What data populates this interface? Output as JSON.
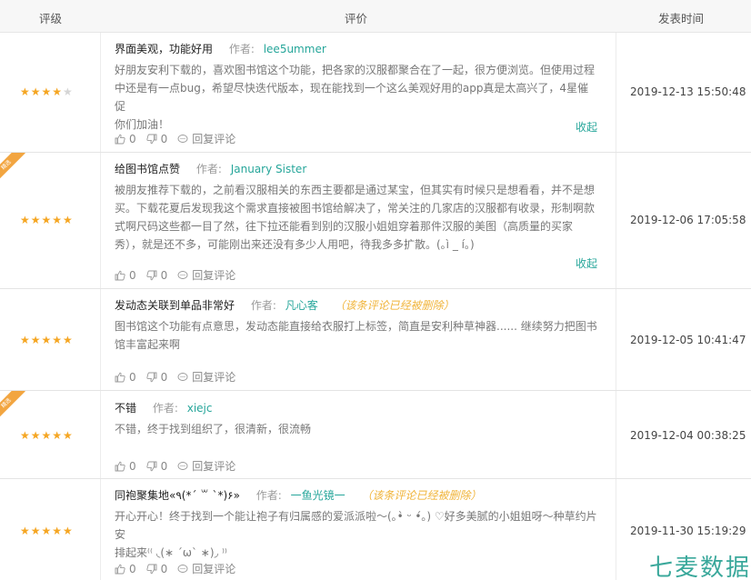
{
  "header": {
    "rating": "评级",
    "review": "评价",
    "time": "发表时间"
  },
  "labels": {
    "author": "作者:",
    "collapse": "收起",
    "reply": "回复评论"
  },
  "reviews": [
    {
      "title": "界面美观，功能好用",
      "author": "lee5ummer",
      "deleted": "",
      "stars": "★★★★",
      "stars_empty": "★",
      "rating": 4,
      "lines": [
        "好朋友安利下载的，喜欢图书馆这个功能，把各家的汉服都聚合在了一起，很方便浏览。但使用过程",
        "中还是有一点bug，希望尽快迭代版本，现在能找到一个这么美观好用的app真是太高兴了，4星催促",
        "你们加油！"
      ],
      "likes": "0",
      "dislikes": "0",
      "time": "2019-12-13 15:50:48",
      "ribbon": ""
    },
    {
      "title": "给图书馆点赞",
      "author": "January Sister",
      "deleted": "",
      "stars": "★★★★★",
      "stars_empty": "",
      "rating": 5,
      "lines": [
        "被朋友推荐下载的，之前看汉服相关的东西主要都是通过某宝，但其实有时候只是想看看，并不是想",
        "买。下载花夏后发现我这个需求直接被图书馆给解决了，常关注的几家店的汉服都有收录，形制啊款",
        "式啊尺码这些都一目了然，往下拉还能看到别的汉服小姐姐穿着那件汉服的美图（高质量的买家",
        "秀），就是还不多，可能刚出来还没有多少人用吧，待我多多扩散。(｡ì _ í｡)"
      ],
      "likes": "0",
      "dislikes": "0",
      "time": "2019-12-06 17:05:58",
      "ribbon": "精选"
    },
    {
      "title": "发动态关联到单品非常好",
      "author": "凡心客",
      "deleted": "（该条评论已经被删除）",
      "stars": "★★★★★",
      "stars_empty": "",
      "rating": 5,
      "lines": [
        "图书馆这个功能有点意思，发动态能直接给衣服打上标签，简直是安利种草神器...... 继续努力把图书",
        "馆丰富起来啊"
      ],
      "likes": "0",
      "dislikes": "0",
      "time": "2019-12-05 10:41:47",
      "ribbon": ""
    },
    {
      "title": "不错",
      "author": "xiejc",
      "deleted": "",
      "stars": "★★★★★",
      "stars_empty": "",
      "rating": 5,
      "lines": [
        "不错，终于找到组织了，很清新，很流畅"
      ],
      "likes": "0",
      "dislikes": "0",
      "time": "2019-12-04 00:38:25",
      "ribbon": "精选"
    },
    {
      "title": "同袍聚集地«٩(*´ ꒳ `*)۶»",
      "author": "一鱼光镜一",
      "deleted": "（该条评论已经被删除）",
      "stars": "★★★★★",
      "stars_empty": "",
      "rating": 5,
      "lines": [
        "开心开心！终于找到一个能让袍子有归属感的爱派派啦～(｡•̀ ᵕ •́｡) ♡好多美腻的小姐姐呀～种草约片安",
        "排起来⁽⁽ ◟(∗ ˊωˋ ∗)◞ ⁾⁾"
      ],
      "likes": "0",
      "dislikes": "0",
      "time": "2019-11-30 15:19:29",
      "ribbon": ""
    }
  ],
  "watermark": "七麦数据",
  "colors": {
    "accent": "#26a69a",
    "star": "#f5a623",
    "ribbon": "#f2a540",
    "deleted": "#f0b43a"
  }
}
